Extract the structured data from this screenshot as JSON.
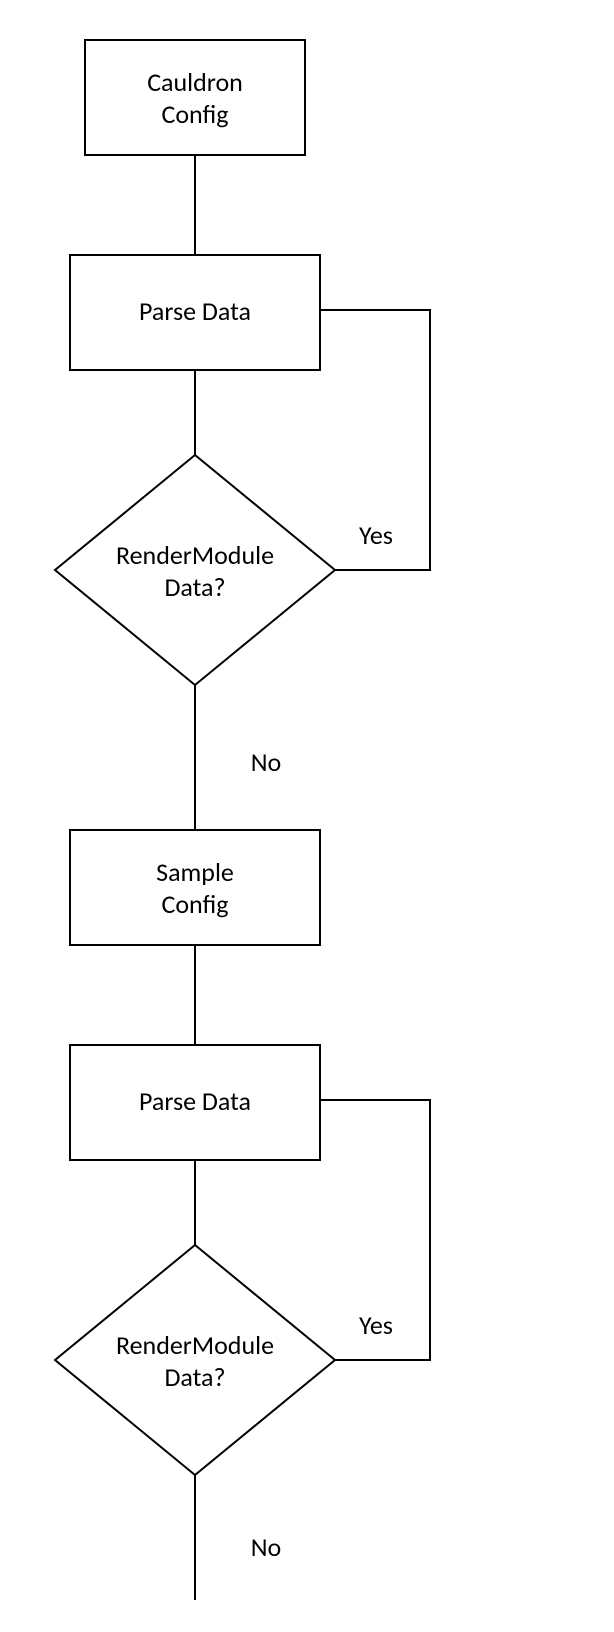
{
  "chart_data": {
    "type": "flowchart",
    "nodes": [
      {
        "id": "cauldron",
        "shape": "rect",
        "lines": [
          "Cauldron",
          "Config"
        ]
      },
      {
        "id": "parse1",
        "shape": "rect",
        "lines": [
          "Parse Data"
        ]
      },
      {
        "id": "decision1",
        "shape": "diamond",
        "lines": [
          "RenderModule",
          "Data?"
        ]
      },
      {
        "id": "sample",
        "shape": "rect",
        "lines": [
          "Sample",
          "Config"
        ]
      },
      {
        "id": "parse2",
        "shape": "rect",
        "lines": [
          "Parse Data"
        ]
      },
      {
        "id": "decision2",
        "shape": "diamond",
        "lines": [
          "RenderModule",
          "Data?"
        ]
      }
    ],
    "edges": [
      {
        "from": "cauldron",
        "to": "parse1",
        "label": ""
      },
      {
        "from": "parse1",
        "to": "decision1",
        "label": ""
      },
      {
        "from": "decision1",
        "to": "parse1",
        "label": "Yes"
      },
      {
        "from": "decision1",
        "to": "sample",
        "label": "No"
      },
      {
        "from": "sample",
        "to": "parse2",
        "label": ""
      },
      {
        "from": "parse2",
        "to": "decision2",
        "label": ""
      },
      {
        "from": "decision2",
        "to": "parse2",
        "label": "Yes"
      },
      {
        "from": "decision2",
        "to": "end",
        "label": "No"
      }
    ],
    "labels": {
      "yes": "Yes",
      "no": "No"
    }
  }
}
